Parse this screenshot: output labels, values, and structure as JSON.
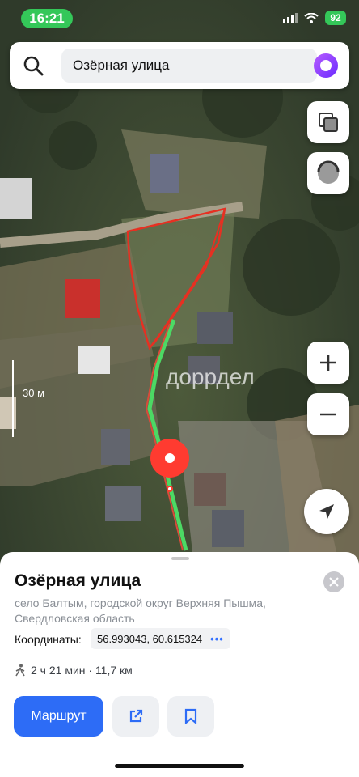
{
  "status_bar": {
    "time": "16:21",
    "battery": "92"
  },
  "search": {
    "query": "Озёрная улица"
  },
  "map": {
    "scale": "30 м",
    "watermark": "доррдел"
  },
  "sheet": {
    "title": "Озёрная улица",
    "address": "село Балтым, городской округ Верхняя Пышма, Свердловская область",
    "coords_label": "Координаты:",
    "coords_value": "56.993043, 60.615324",
    "walk_info": "2 ч 21 мин · 11,7 км",
    "route_button": "Маршрут"
  },
  "colors": {
    "accent": "#2d6cf6",
    "pin": "#ff3b30",
    "route": "#4cd964"
  },
  "icons": [
    "search-icon",
    "alice-icon",
    "layers-icon",
    "ring-icon",
    "plus-icon",
    "minus-icon",
    "navigate-icon",
    "close-icon",
    "walking-icon",
    "share-icon",
    "bookmark-icon",
    "location-pin-icon"
  ]
}
